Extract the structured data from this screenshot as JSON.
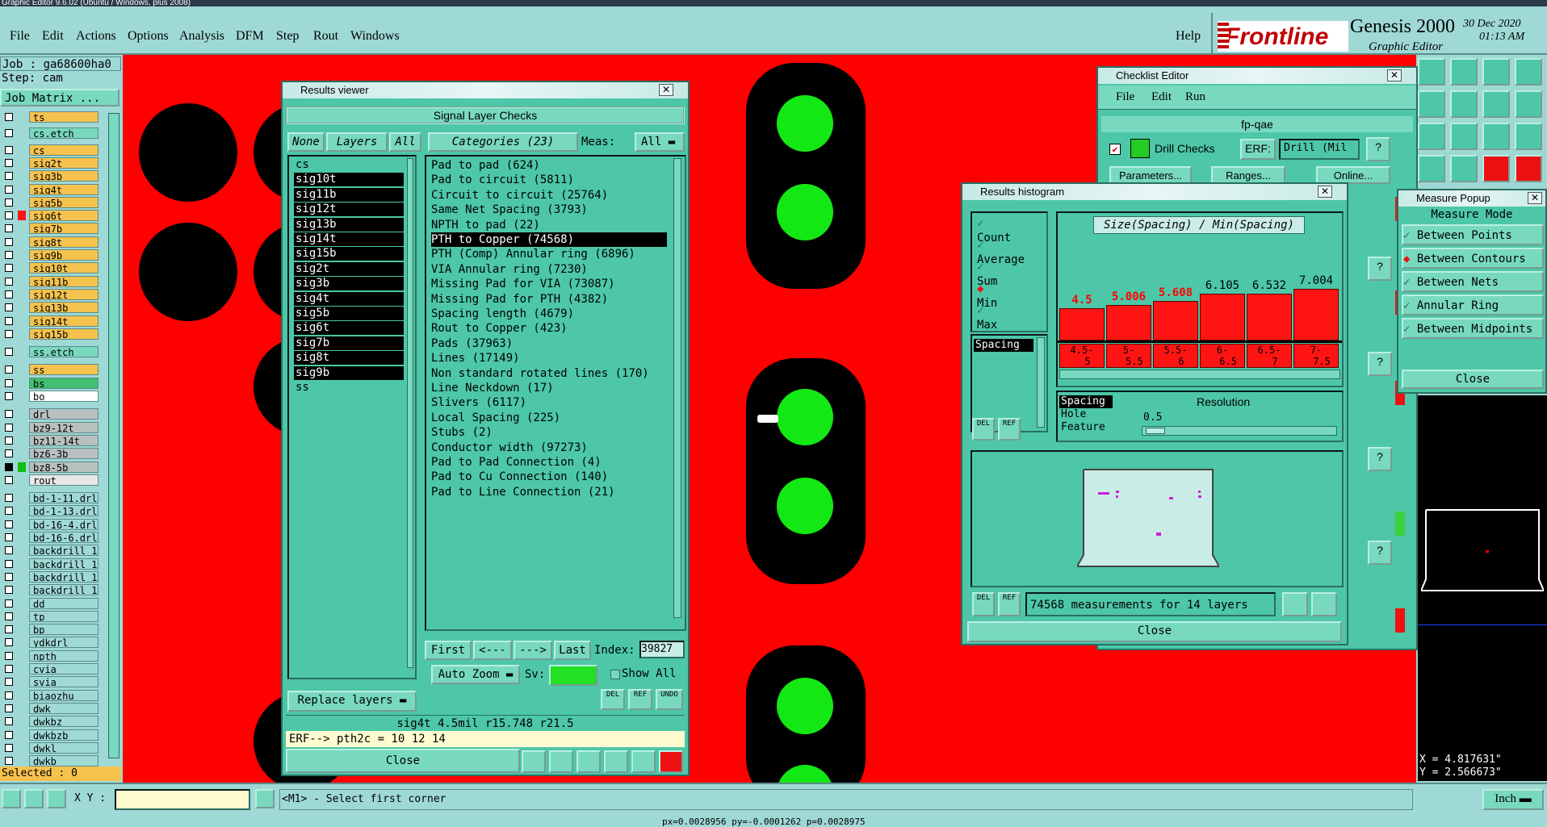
{
  "window_title": "Graphic Editor 9.6.02 (Ubuntu / Windows, plus 2008)",
  "menu": [
    "File",
    "Edit",
    "Actions",
    "Options",
    "Analysis",
    "DFM",
    "Step",
    "Rout",
    "Windows"
  ],
  "help": "Help",
  "brand": {
    "logo": "Frontline",
    "product": "Genesis 2000",
    "subtitle": "Graphic Editor",
    "date": "30 Dec 2020",
    "time": "01:13 AM"
  },
  "job": {
    "job": "Job : ga68600ha0",
    "step": "Step: cam",
    "matrix_button": "Job Matrix ..."
  },
  "layers": [
    "ts",
    "cs.etch",
    "cs",
    "sig2t",
    "sig3b",
    "sig4t",
    "sig5b",
    "sig6t",
    "sig7b",
    "sig8t",
    "sig9b",
    "sig10t",
    "sig11b",
    "sig12t",
    "sig13b",
    "sig14t",
    "sig15b",
    "ss.etch",
    "ss",
    "bs",
    "bo",
    "drl",
    "bz9-12t",
    "bz11-14t",
    "bz6-3b",
    "bz8-5b",
    "rout",
    "bd-1-11.drl",
    "bd-1-13.drl",
    "bd-16-4.drl",
    "bd-16-6.drl",
    "backdrill_1-",
    "backdrill_1-",
    "backdrill_16",
    "backdrill_16",
    "dd",
    "tp",
    "bp",
    "ydkdrl",
    "npth",
    "cvia",
    "svia",
    "biaozhu",
    "dwk",
    "dwkbz",
    "dwkbzb",
    "dwkl",
    "dwkb"
  ],
  "selected": "Selected : 0",
  "results_viewer": {
    "title": "Results viewer",
    "section": "Signal Layer Checks",
    "none_btn": "None",
    "layers_btn": "Layers",
    "all_btn": "All",
    "categories_btn": "Categories (23)",
    "meas_label": "Meas:",
    "meas_value": "All",
    "layer_list": [
      "cs",
      "sig10t",
      "sig11b",
      "sig12t",
      "sig13b",
      "sig14t",
      "sig15b",
      "sig2t",
      "sig3b",
      "sig4t",
      "sig5b",
      "sig6t",
      "sig7b",
      "sig8t",
      "sig9b",
      "ss"
    ],
    "categories": [
      "Pad to pad (624)",
      "Pad to circuit (5811)",
      "Circuit to circuit (25764)",
      "Same Net Spacing (3793)",
      "NPTH to pad (22)",
      "PTH to Copper (74568)",
      "PTH (Comp) Annular ring (6896)",
      "VIA Annular ring (7230)",
      "Missing Pad for VIA (73087)",
      "Missing Pad for PTH (4382)",
      "Spacing length (4679)",
      "Rout to Copper (423)",
      "Pads (37963)",
      "Lines (17149)",
      "Non standard rotated lines (170)",
      "Line Neckdown (17)",
      "Slivers (6117)",
      "Local Spacing (225)",
      "Stubs (2)",
      "Conductor width (97273)",
      "Pad to Pad Connection (4)",
      "Pad to Cu Connection (140)",
      "Pad to Line Connection (21)"
    ],
    "nav": {
      "first": "First",
      "prev": "<---",
      "next": "--->",
      "last": "Last",
      "index_label": "Index:",
      "index_value": "39827"
    },
    "auto_zoom": "Auto Zoom",
    "sv_label": "Sv:",
    "show_all": "Show All",
    "replace_layers": "Replace layers",
    "del": "DEL",
    "ref": "REF",
    "undo": "UNDO",
    "info": "sig4t 4.5mil  r15.748  r21.5",
    "erf": "ERF--> pth2c = 10 12 14",
    "close": "Close"
  },
  "histogram": {
    "title": "Results histogram",
    "chart_title": "Size(Spacing) / Min(Spacing)",
    "modes": [
      "Count",
      "Average",
      "Sum",
      "Min",
      "Max"
    ],
    "selected_mode": "Min",
    "field": "Spacing",
    "bars": [
      {
        "value": "4.5",
        "bin": [
          "4.5-",
          "5"
        ],
        "h": 0.4
      },
      {
        "value": "5.006",
        "bin": [
          "5-",
          "5.5"
        ],
        "h": 0.44
      },
      {
        "value": "5.608",
        "bin": [
          "5.5-",
          "6"
        ],
        "h": 0.49
      },
      {
        "value": "6.105",
        "bin": [
          "6-",
          "6.5"
        ],
        "h": 0.58
      },
      {
        "value": "6.532",
        "bin": [
          "6.5-",
          "7"
        ],
        "h": 0.58
      },
      {
        "value": "7.004",
        "bin": [
          "7-",
          "7.5"
        ],
        "h": 0.64
      }
    ],
    "fields": [
      "Spacing",
      "Hole",
      "Feature"
    ],
    "resolution_label": "Resolution",
    "resolution_value": "0.5",
    "del": "DEL",
    "ref": "REF",
    "summary": "74568 measurements for 14 layers",
    "close": "Close"
  },
  "checklist": {
    "title": "Checklist Editor",
    "menu": [
      "File",
      "Edit",
      "Run"
    ],
    "name": "fp-qae",
    "check": "Drill Checks",
    "erf_label": "ERF:",
    "erf_value": "Drill (Mil",
    "buttons": [
      "Parameters...",
      "Ranges...",
      "Online..."
    ],
    "help": "?"
  },
  "measure": {
    "title": "Measure Popup",
    "mode_label": "Measure Mode",
    "options": [
      "Between Points",
      "Between Contours",
      "Between Nets",
      "Annular Ring",
      "Between Midpoints"
    ],
    "selected": "Between Contours",
    "close": "Close"
  },
  "coords": {
    "x": "X = 4.817631\"",
    "y": "Y = 2.566673\""
  },
  "status": {
    "xy_label": "X Y :",
    "prompt": "<M1> - Select first corner",
    "unit": "Inch",
    "bottom": "px=0.0028956  py=-0.0001262  p=0.0028975"
  }
}
